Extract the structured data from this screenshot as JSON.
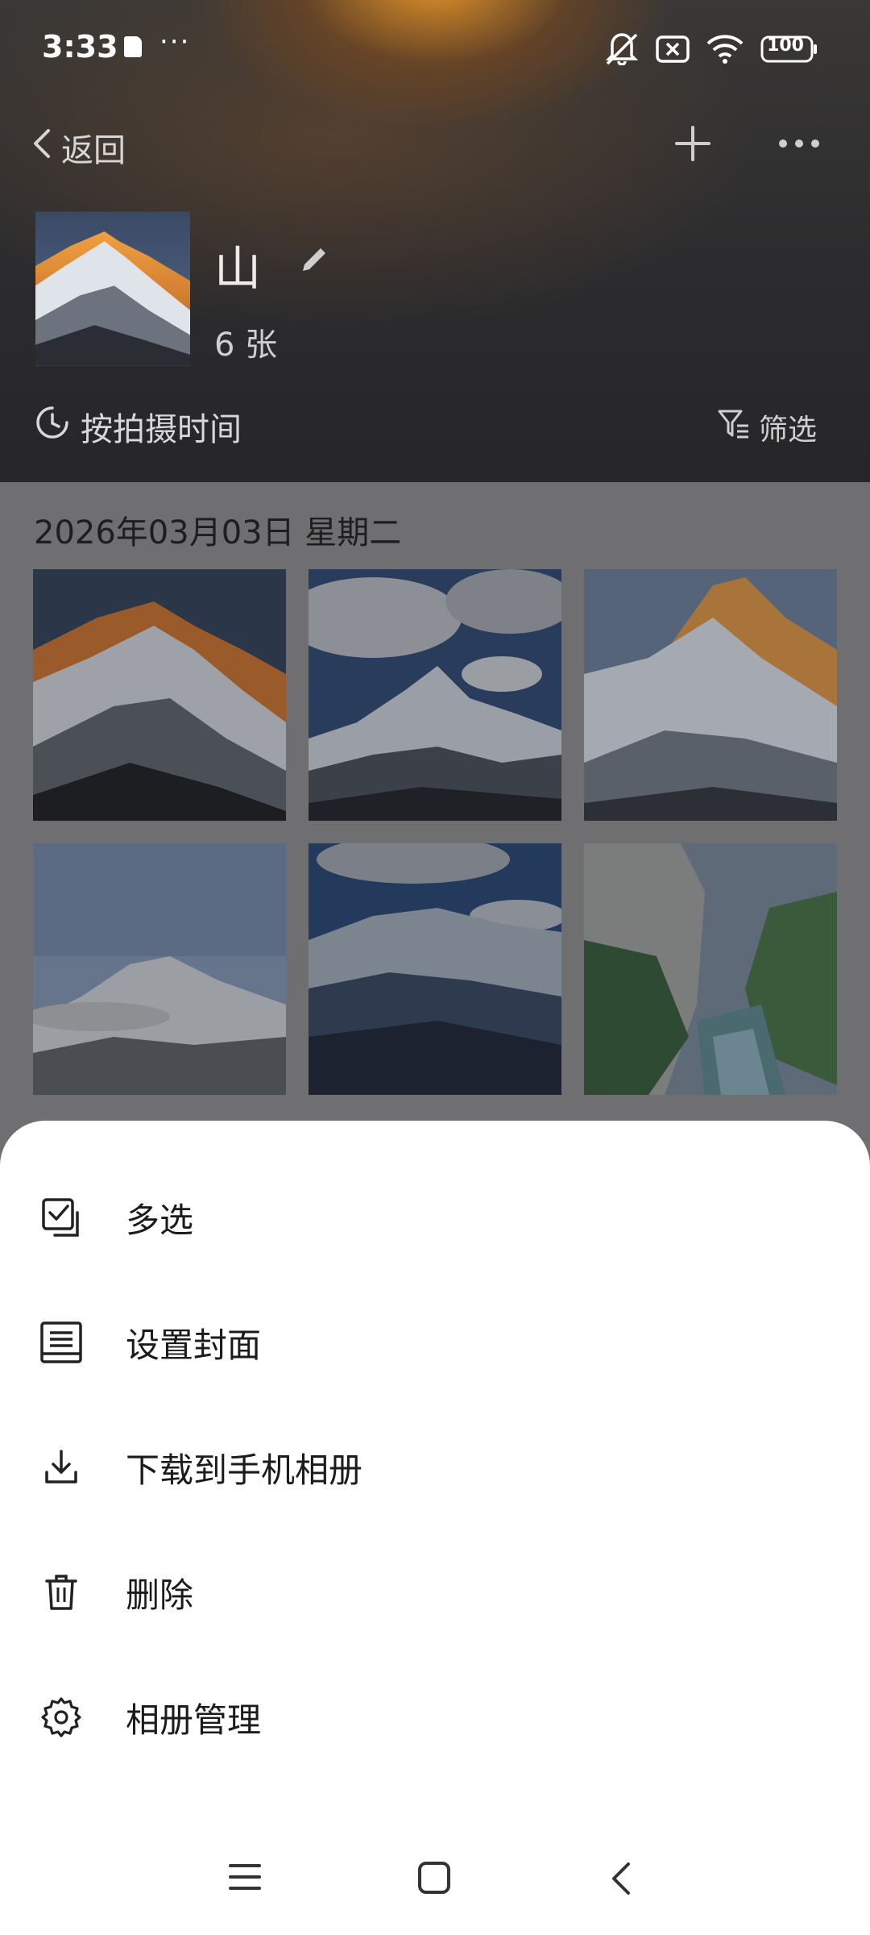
{
  "status_bar": {
    "time": "3:33",
    "battery": "100"
  },
  "nav": {
    "back_label": "返回"
  },
  "album": {
    "title": "山",
    "count": "6 张"
  },
  "toolbar": {
    "sort_label": "按拍摄时间",
    "filter_label": "筛选"
  },
  "content": {
    "date": "2026年03月03日 星期二"
  },
  "menu": {
    "items": [
      {
        "label": "多选",
        "icon": "multi-select-icon"
      },
      {
        "label": "设置封面",
        "icon": "cover-icon"
      },
      {
        "label": "下载到手机相册",
        "icon": "download-icon"
      },
      {
        "label": "删除",
        "icon": "trash-icon"
      },
      {
        "label": "相册管理",
        "icon": "gear-icon"
      }
    ]
  },
  "colors": {
    "sheet_background": "#ffffff",
    "dim_overlay": "#6f6f71",
    "peak_glow": "#e8962a"
  }
}
